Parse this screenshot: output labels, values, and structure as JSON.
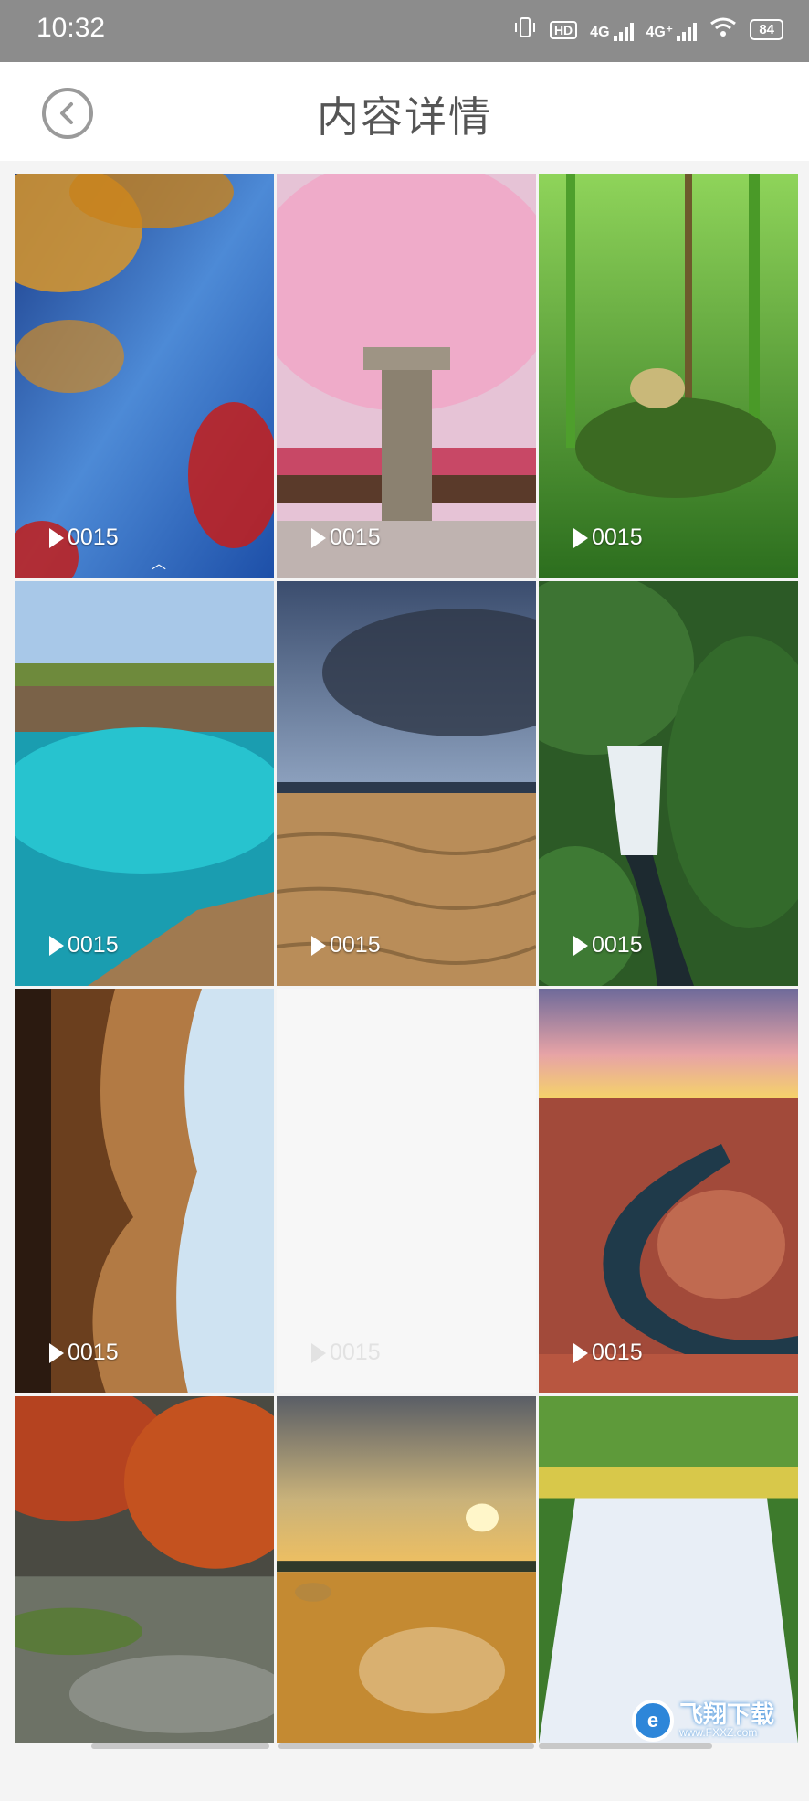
{
  "status_bar": {
    "time": "10:32",
    "hd_label": "HD",
    "net1": "4G",
    "net2": "4G⁺",
    "battery": "84"
  },
  "header": {
    "title": "内容详情",
    "back_icon": "chevron-left-icon"
  },
  "grid": {
    "items": [
      {
        "label": "0015"
      },
      {
        "label": "0015"
      },
      {
        "label": "0015"
      },
      {
        "label": "0015"
      },
      {
        "label": "0015"
      },
      {
        "label": "0015"
      },
      {
        "label": "0015"
      },
      {
        "label": "0015"
      },
      {
        "label": "0015"
      },
      {
        "label": ""
      },
      {
        "label": ""
      },
      {
        "label": ""
      }
    ]
  },
  "watermark": {
    "logo": "e",
    "text": "飞翔下载",
    "sub": "www.FXXZ.com"
  },
  "colors": {
    "status_bg": "#8c8c8c",
    "header_bg": "#ffffff",
    "title_color": "#555555"
  }
}
